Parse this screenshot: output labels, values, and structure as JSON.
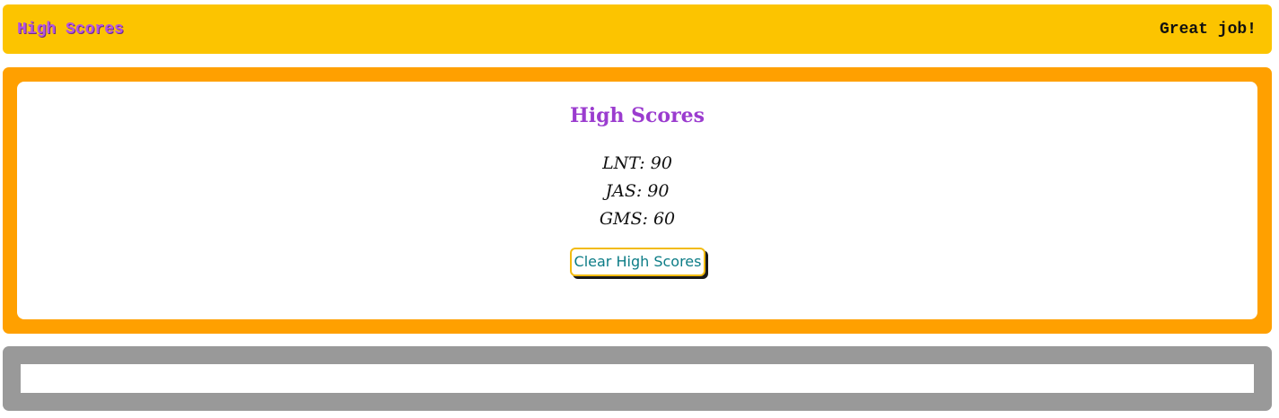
{
  "header": {
    "high_scores_link": "High Scores",
    "message": "Great job!"
  },
  "main": {
    "title": "High Scores",
    "scores": [
      {
        "text": "LNT: 90"
      },
      {
        "text": "JAS: 90"
      },
      {
        "text": "GMS: 60"
      }
    ],
    "clear_button_label": "Clear High Scores"
  },
  "colors": {
    "header_bg": "#fcc400",
    "main_border": "#ffa000",
    "footer_border": "#999999",
    "title_color": "#9b3ccf",
    "button_text": "#0c7c86",
    "button_border": "#f2bb10"
  }
}
